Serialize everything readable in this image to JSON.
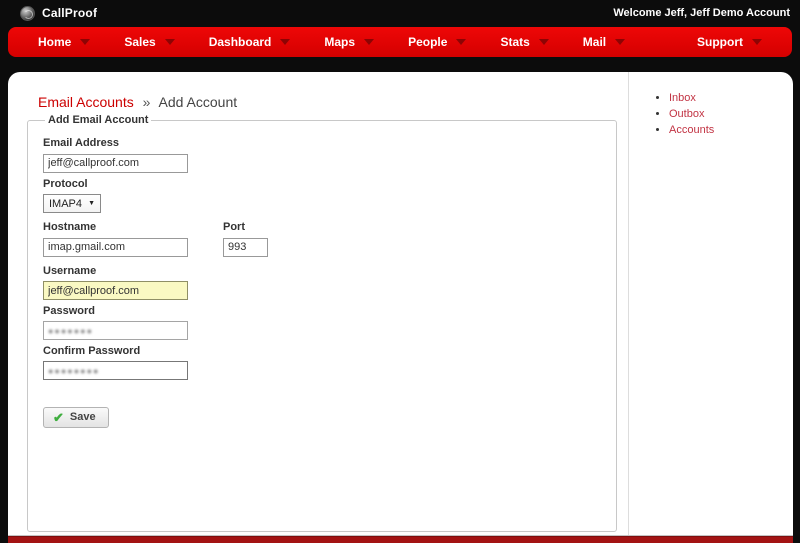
{
  "header": {
    "brand": "CallProof",
    "welcome": "Welcome Jeff, Jeff Demo Account"
  },
  "nav": {
    "items": [
      {
        "label": "Home"
      },
      {
        "label": "Sales"
      },
      {
        "label": "Dashboard"
      },
      {
        "label": "Maps"
      },
      {
        "label": "People"
      },
      {
        "label": "Stats"
      },
      {
        "label": "Mail"
      },
      {
        "label": "Support"
      }
    ]
  },
  "breadcrumb": {
    "section": "Email Accounts",
    "separator": "»",
    "current": "Add Account"
  },
  "form": {
    "legend": "Add Email Account",
    "email": {
      "label": "Email Address",
      "value": "jeff@callproof.com"
    },
    "protocol": {
      "label": "Protocol",
      "value": "IMAP4",
      "caret": "▼"
    },
    "hostname": {
      "label": "Hostname",
      "value": "imap.gmail.com"
    },
    "port": {
      "label": "Port",
      "value": "993"
    },
    "username": {
      "label": "Username",
      "value": "jeff@callproof.com"
    },
    "password": {
      "label": "Password",
      "masked": "●●●●●●●"
    },
    "confirm_password": {
      "label": "Confirm Password",
      "masked": "●●●●●●●●"
    },
    "save_label": "Save",
    "check_icon": "✔"
  },
  "sidebar": {
    "links": [
      {
        "label": "Inbox"
      },
      {
        "label": "Outbox"
      },
      {
        "label": "Accounts"
      }
    ]
  },
  "colors": {
    "nav_red": "#dd0404",
    "footer_red": "#a31313",
    "link_red": "#cc0000",
    "sidebar_link": "#c23343",
    "autofill_yellow": "#faf9c3",
    "check_green": "#3fae3f"
  }
}
